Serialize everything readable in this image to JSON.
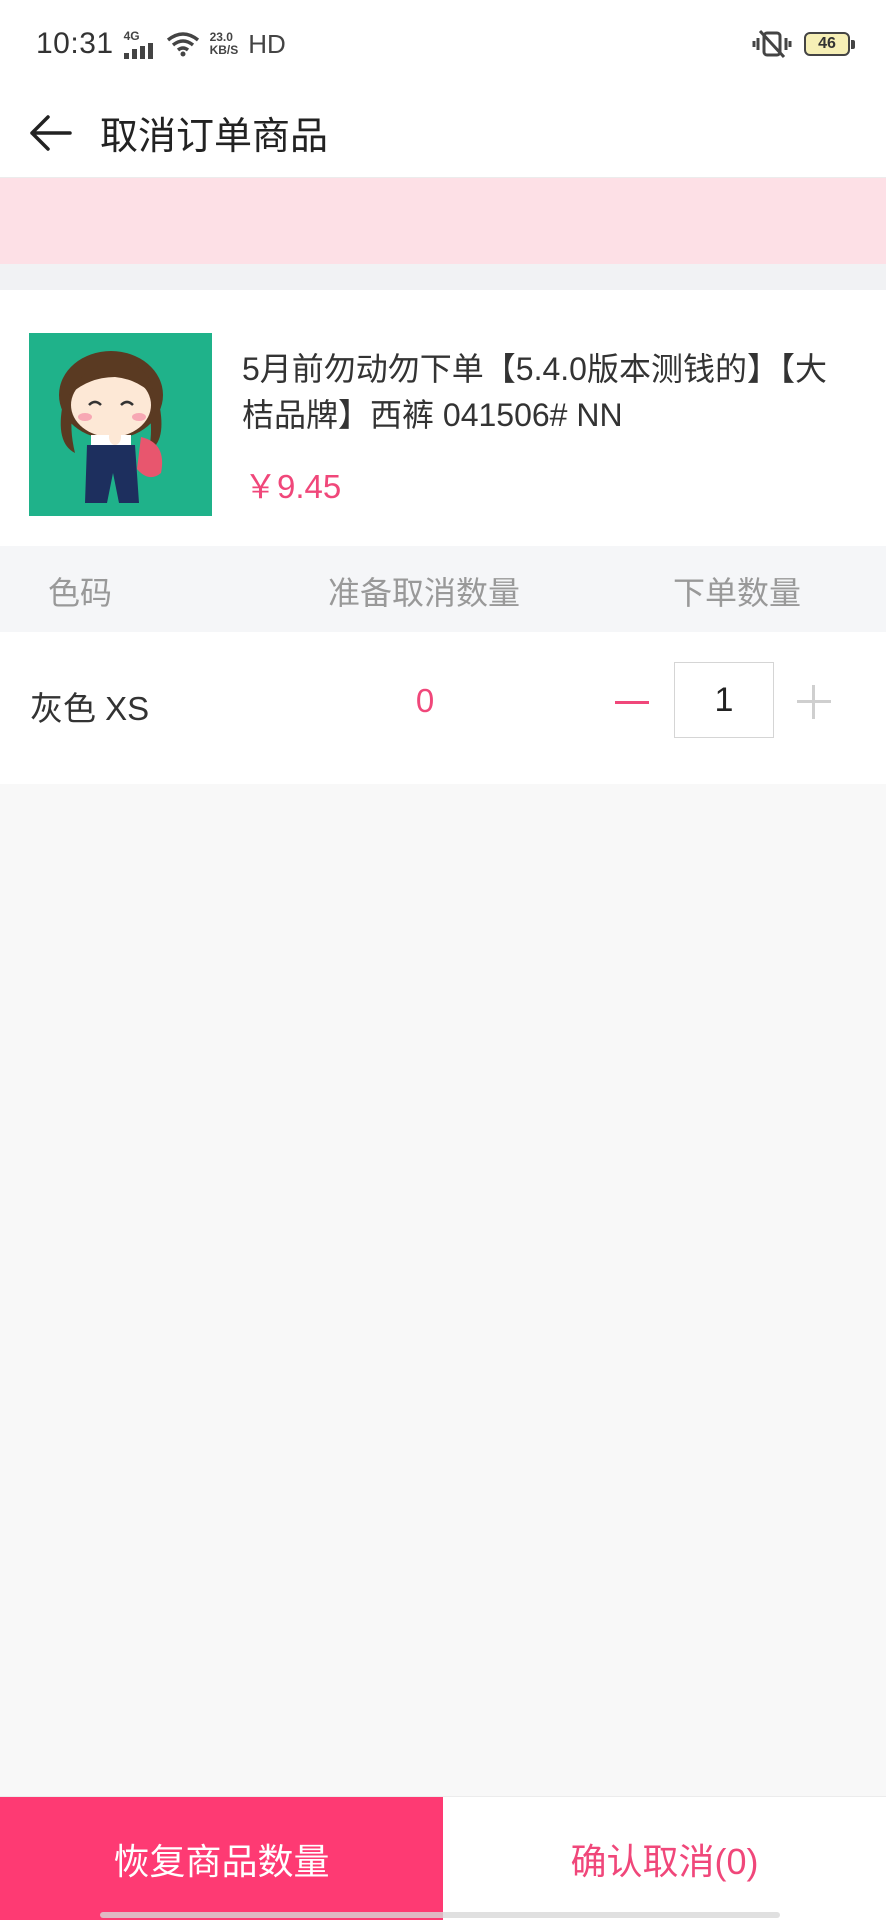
{
  "status_bar": {
    "time": "10:31",
    "network": "4G",
    "speed_value": "23.0",
    "speed_unit": "KB/S",
    "hd": "HD",
    "battery": "46"
  },
  "header": {
    "title": "取消订单商品",
    "back_icon": "arrow-left-icon"
  },
  "product": {
    "name": "5月前勿动勿下单【5.4.0版本测钱的】【大桔品牌】西裤  041506#  NN",
    "price": "￥9.45"
  },
  "table": {
    "columns": [
      "色码",
      "准备取消数量",
      "下单数量"
    ],
    "rows": [
      {
        "color_size": "灰色 XS",
        "cancel_qty": "0",
        "order_qty": "1"
      }
    ]
  },
  "bottom": {
    "restore_label": "恢复商品数量",
    "confirm_label": "确认取消(0)"
  },
  "colors": {
    "accent": "#fe3a73",
    "price": "#f0477a",
    "banner": "#fde0e6"
  }
}
